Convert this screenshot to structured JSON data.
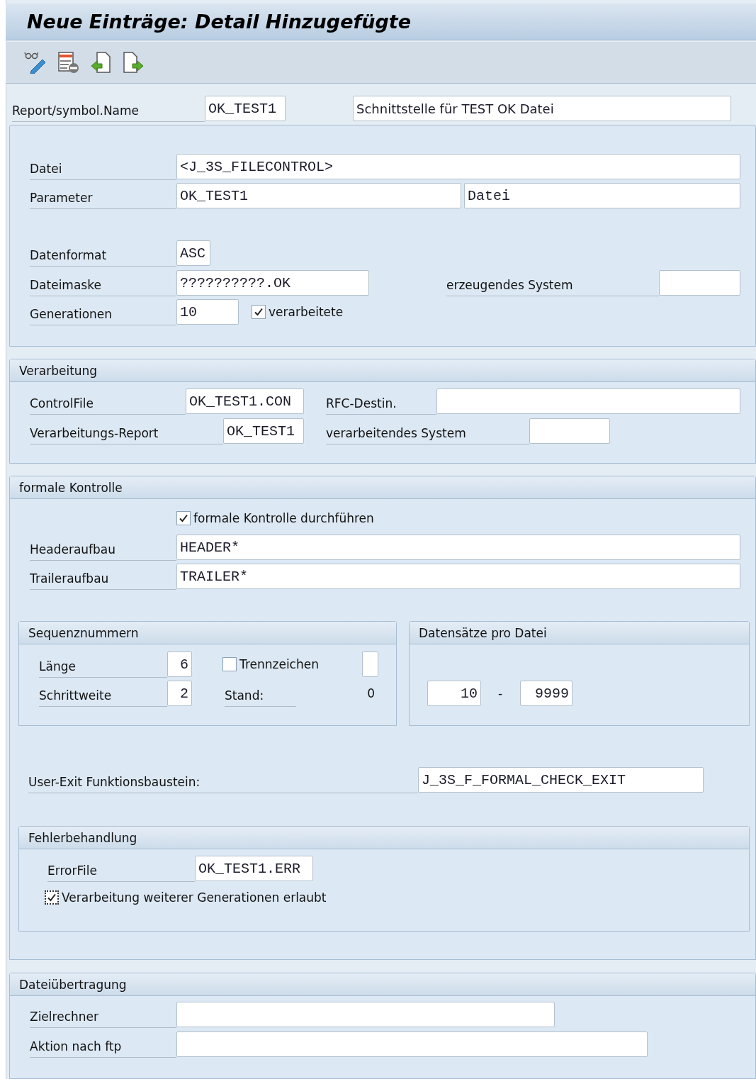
{
  "title": "Neue Einträge: Detail Hinzugefügte",
  "header": {
    "label": "Report/symbol.Name",
    "name": "OK_TEST1",
    "description": "Schnittstelle für TEST OK Datei"
  },
  "file": {
    "datei": {
      "label": "Datei",
      "value": "<J_3S_FILECONTROL>"
    },
    "parameter": {
      "label": "Parameter",
      "value": "OK_TEST1",
      "value_2": "Datei"
    },
    "datenformat": {
      "label": "Datenformat",
      "value": "ASC"
    },
    "dateimaske": {
      "label": "Dateimaske",
      "value": "??????????.OK"
    },
    "erzeugendes_system": {
      "label": "erzeugendes System"
    },
    "generationen": {
      "label": "Generationen",
      "value": "10"
    },
    "verarbeitete": {
      "label": "verarbeitete",
      "checked": true
    }
  },
  "verarbeitung": {
    "title": "Verarbeitung",
    "controlfile": {
      "label": "ControlFile",
      "value": "OK_TEST1.CON"
    },
    "rfc_destin": {
      "label": "RFC-Destin."
    },
    "report": {
      "label": "Verarbeitungs-Report",
      "value": "OK_TEST1"
    },
    "verarbeitendes_system": {
      "label": "verarbeitendes System"
    }
  },
  "formale_kontrolle": {
    "title": "formale Kontrolle",
    "durchfuehren": {
      "label": "formale Kontrolle durchführen",
      "checked": true
    },
    "headeraufbau": {
      "label": "Headeraufbau",
      "value": "HEADER*"
    },
    "traileraufbau": {
      "label": "Traileraufbau",
      "value": "TRAILER*"
    },
    "sequenznummern": {
      "title": "Sequenznummern",
      "laenge": {
        "label": "Länge",
        "value": "6"
      },
      "trennzeichen": {
        "label": "Trennzeichen",
        "checked": false
      },
      "schrittweite": {
        "label": "Schrittweite",
        "value": "2"
      },
      "stand": {
        "label": "Stand:",
        "value": "0"
      }
    },
    "datensaetze": {
      "title": "Datensätze pro Datei",
      "from": "10",
      "separator": "-",
      "to": "9999"
    },
    "user_exit": {
      "label": "User-Exit Funktionsbaustein:",
      "value": "J_3S_F_FORMAL_CHECK_EXIT"
    },
    "fehlerbehandlung": {
      "title": "Fehlerbehandlung",
      "errorfile": {
        "label": "ErrorFile",
        "value": "OK_TEST1.ERR"
      },
      "weitere": {
        "label": "Verarbeitung weiterer Generationen erlaubt",
        "checked": true,
        "focused": true
      }
    }
  },
  "dateiuebertragung": {
    "title": "Dateiübertragung",
    "zielrechner": {
      "label": "Zielrechner"
    },
    "aktion": {
      "label": "Aktion nach ftp"
    }
  }
}
